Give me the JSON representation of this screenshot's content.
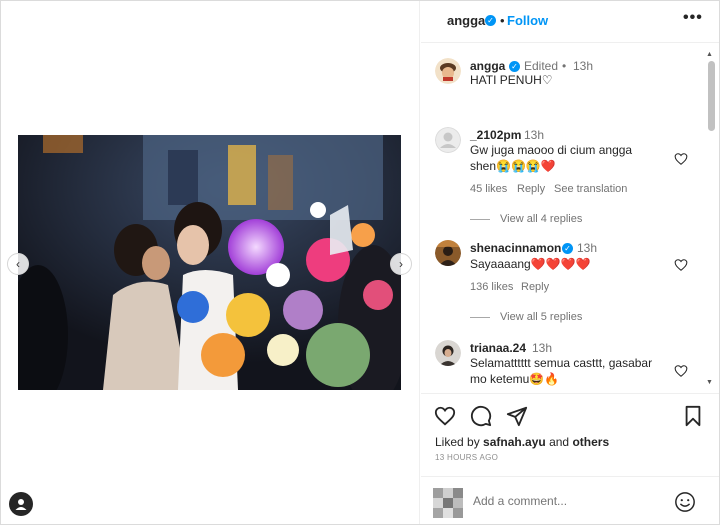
{
  "header": {
    "username": "angga",
    "separator": "•",
    "follow_label": "Follow",
    "more_label": "•••"
  },
  "caption": {
    "username": "angga",
    "edited": "Edited",
    "dot": "•",
    "time": "13h",
    "text": "HATI PENUH♡"
  },
  "comments": [
    {
      "username": "_2102pm",
      "time": "13h",
      "text_line1": "Gw juga maooo di cium angga",
      "text_line2": "shen😭😭😭❤️",
      "likes": "45 likes",
      "reply_label": "Reply",
      "translate_label": "See translation",
      "view_replies": "View all 4 replies"
    },
    {
      "username": "shenacinnamon",
      "time": "13h",
      "text": "Sayaaaang❤️❤️❤️❤️",
      "likes": "136 likes",
      "reply_label": "Reply",
      "view_replies": "View all 5 replies"
    },
    {
      "username": "trianaa.24",
      "time": "13h",
      "text_line1": "Selamatttttt semua casttt, gasabar",
      "text_line2": "mo ketemu🤩🔥"
    }
  ],
  "actions": {
    "liked_by_prefix": "Liked by ",
    "liked_by_user": "safnah.ayu",
    "liked_by_and": " and ",
    "liked_by_others": "others",
    "time_ago": "13 HOURS AGO"
  },
  "comment_box": {
    "placeholder": "Add a comment..."
  },
  "icons": [
    "verified-badge-icon",
    "heart-icon",
    "comment-icon",
    "share-icon",
    "bookmark-icon",
    "emoji-icon",
    "chevron-left-icon",
    "chevron-right-icon",
    "user-icon"
  ],
  "colors": {
    "accent": "#0095f6",
    "text": "#262626",
    "muted": "#737373",
    "heart_red": "#e0245e"
  }
}
